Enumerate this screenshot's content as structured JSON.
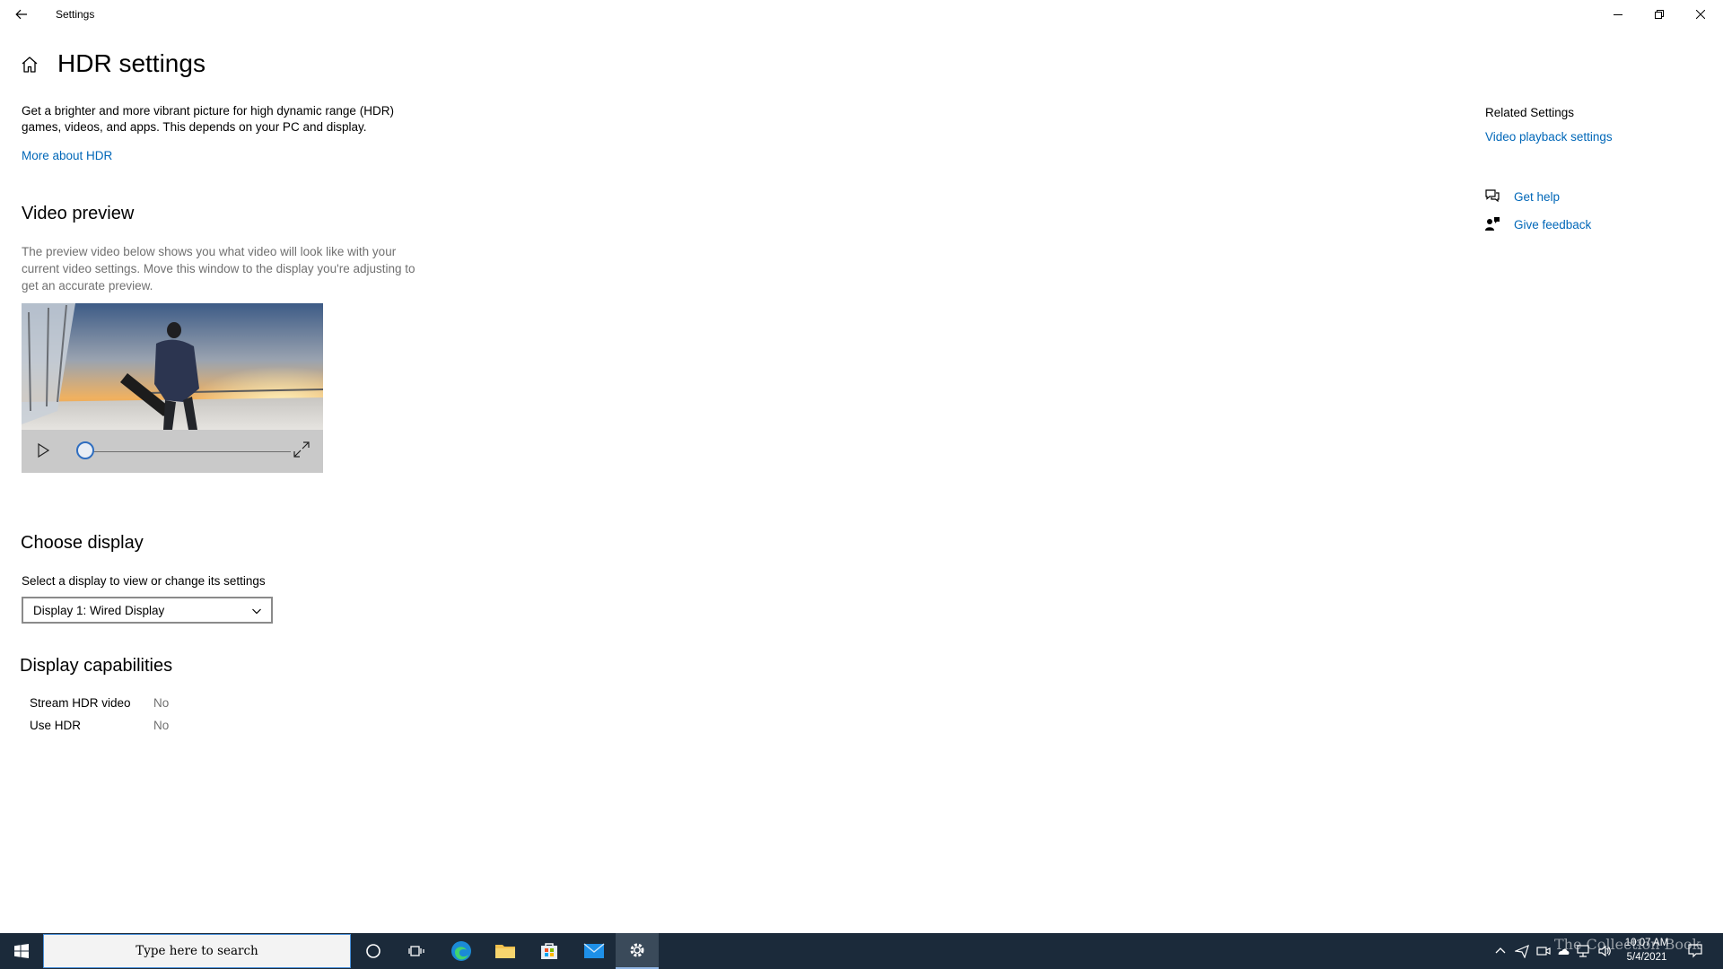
{
  "window": {
    "title": "Settings"
  },
  "header": {
    "title": "HDR settings"
  },
  "intro": {
    "text": "Get a brighter and more vibrant picture for high dynamic range (HDR) games, videos, and apps. This depends on your PC and display.",
    "link": "More about HDR"
  },
  "video_preview": {
    "heading": "Video preview",
    "description": "The preview video below shows you what video will look like with your current video settings. Move this window to the display you're adjusting to get an accurate preview.",
    "progress": 0
  },
  "choose_display": {
    "heading": "Choose display",
    "label": "Select a display to view or change its settings",
    "selected": "Display 1: Wired Display"
  },
  "capabilities": {
    "heading": "Display capabilities",
    "rows": [
      {
        "name": "Stream HDR video",
        "value": "No"
      },
      {
        "name": "Use HDR",
        "value": "No"
      }
    ]
  },
  "related": {
    "title": "Related Settings",
    "video_playback": "Video playback settings",
    "get_help": "Get help",
    "give_feedback": "Give feedback"
  },
  "taskbar": {
    "search_placeholder": "Type here to search",
    "time": "10:07 AM",
    "date": "5/4/2021",
    "watermark": "The Collection Book"
  },
  "colors": {
    "accent": "#0067b8",
    "taskbar": "#1b2a3a"
  }
}
